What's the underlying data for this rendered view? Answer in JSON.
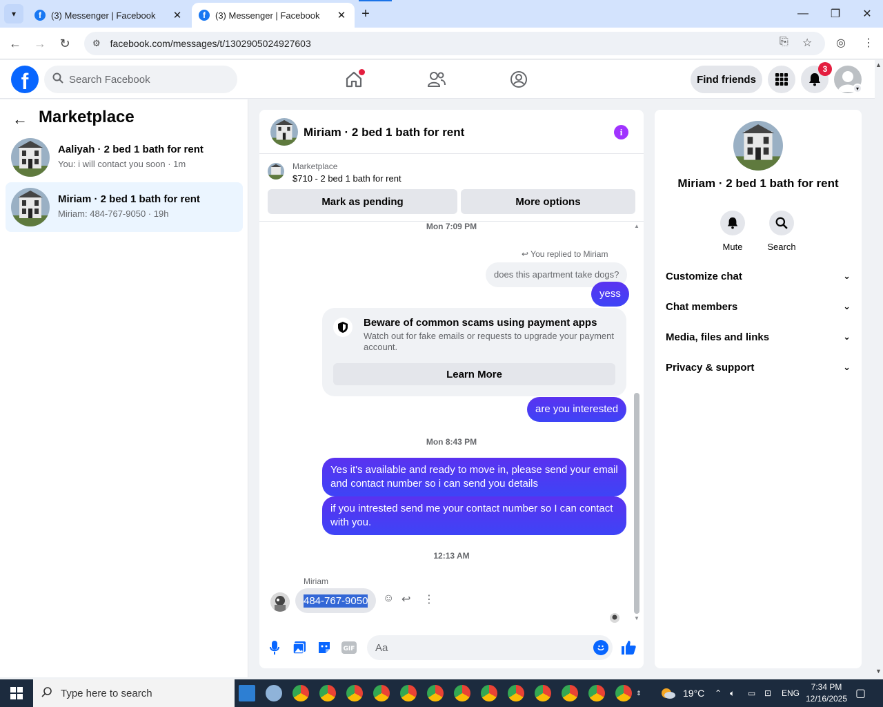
{
  "browser": {
    "tabs": [
      {
        "title": "(3) Messenger | Facebook",
        "active": false
      },
      {
        "title": "(3) Messenger | Facebook",
        "active": true
      }
    ],
    "url": "facebook.com/messages/t/1302905024927603"
  },
  "fb": {
    "logo_letter": "f",
    "search_placeholder": "Search Facebook",
    "find_friends": "Find friends",
    "notification_count": "3"
  },
  "sidebar": {
    "title": "Marketplace",
    "conversations": [
      {
        "name": "Aaliyah · 2 bed 1 bath for rent",
        "snippet": "You: i will contact you soon · 1m",
        "active": false
      },
      {
        "name": "Miriam · 2 bed 1 bath for rent",
        "snippet": "Miriam: 484-767-9050 · 19h",
        "active": true
      }
    ]
  },
  "chat": {
    "title": "Miriam · 2 bed 1 bath for rent",
    "marketplace_label": "Marketplace",
    "listing": "$710 - 2 bed 1 bath for rent",
    "mark_pending": "Mark as pending",
    "more_options": "More options",
    "timestamps": [
      "Mon 7:09 PM",
      "Mon 8:43 PM",
      "12:13 AM"
    ],
    "replied_to": "You replied to Miriam",
    "quoted_message": "does this apartment take dogs?",
    "messages_out": [
      "yess",
      "are you interested",
      "Yes it's available and ready to move in, please send your email and contact number so i can send you details",
      "if you intrested send me your contact number so I can contact with you."
    ],
    "notice": {
      "title": "Beware of common scams using payment apps",
      "body": "Watch out for fake emails or requests to upgrade your payment account.",
      "button": "Learn More"
    },
    "incoming_sender": "Miriam",
    "incoming_message": "484-767-9050",
    "composer_placeholder": "Aa"
  },
  "info_panel": {
    "title": "Miriam · 2 bed 1 bath for rent",
    "actions": [
      "Mute",
      "Search"
    ],
    "sections": [
      "Customize chat",
      "Chat members",
      "Media, files and links",
      "Privacy & support"
    ]
  },
  "taskbar": {
    "search_placeholder": "Type here to search",
    "weather": "19°C",
    "language": "ENG",
    "time": "7:34 PM",
    "date": "12/16/2025"
  },
  "colors": {
    "brand": "#0866ff",
    "message_gradient_top": "#5a32f0",
    "message_gradient_bottom": "#3e44f6",
    "info_icon": "#a033ff",
    "badge": "#e41e3f"
  }
}
